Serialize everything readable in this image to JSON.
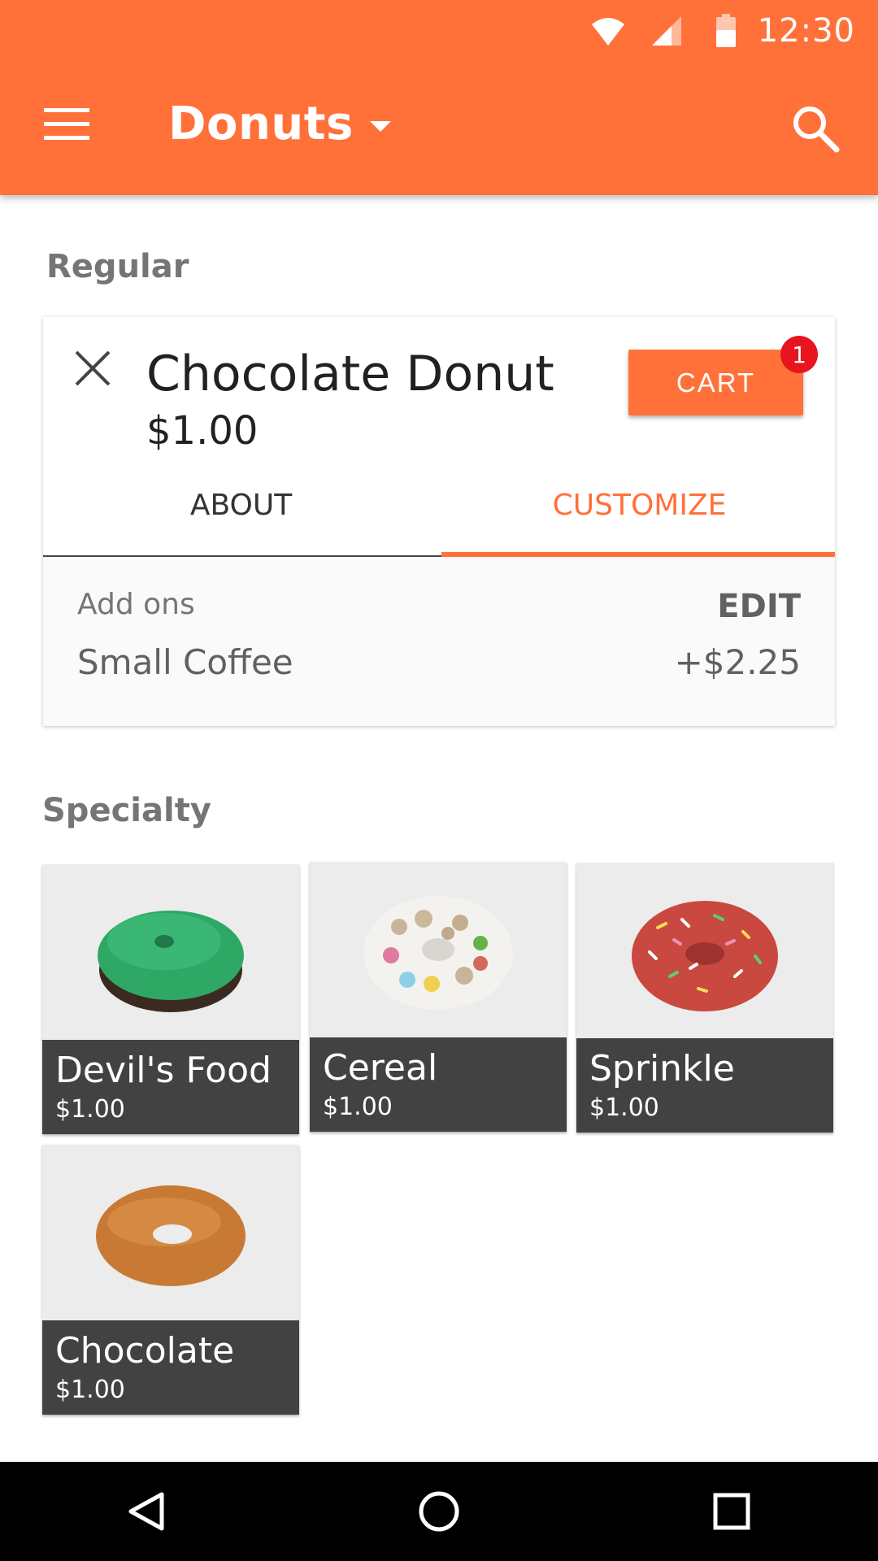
{
  "status_bar": {
    "time": "12:30"
  },
  "app_bar": {
    "title": "Donuts"
  },
  "sections": {
    "regular": "Regular",
    "specialty": "Specialty"
  },
  "selected_item": {
    "name": "Chocolate Donut",
    "price": "$1.00",
    "cart_label": "CART",
    "cart_count": "1",
    "tabs": [
      {
        "label": "ABOUT"
      },
      {
        "label": "CUSTOMIZE"
      }
    ],
    "addons": {
      "label": "Add ons",
      "edit_label": "EDIT",
      "item": "Small Coffee",
      "price": "+$2.25"
    }
  },
  "specialty_items": [
    {
      "name": "Devil's Food",
      "price": "$1.00"
    },
    {
      "name": "Cereal",
      "price": "$1.00"
    },
    {
      "name": "Sprinkle",
      "price": "$1.00"
    },
    {
      "name": "Chocolate",
      "price": "$1.00"
    }
  ],
  "colors": {
    "accent": "#FF7139",
    "badge": "#E8141E",
    "tile_label": "#424242"
  },
  "icons": [
    "wifi-icon",
    "signal-icon",
    "battery-icon",
    "menu-icon",
    "caret-down-icon",
    "search-icon",
    "close-icon",
    "back-icon",
    "home-icon",
    "recents-icon"
  ]
}
